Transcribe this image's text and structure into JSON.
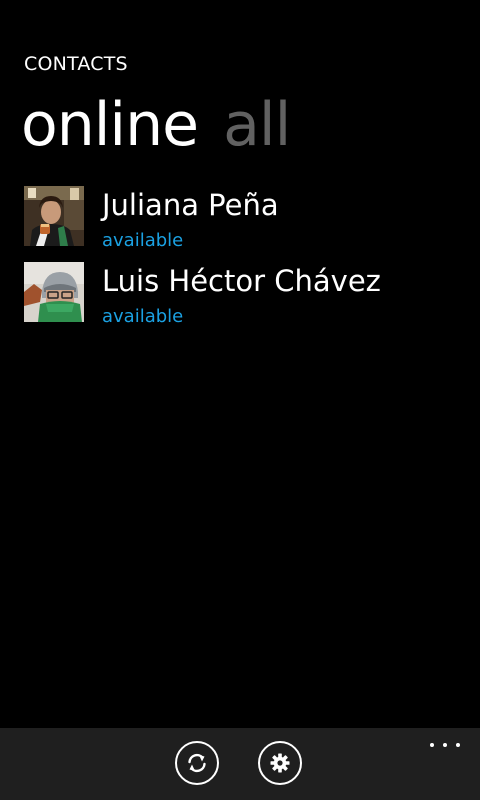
{
  "header": {
    "app_title": "CONTACTS"
  },
  "pivot": {
    "items": [
      {
        "label": "online",
        "active": true
      },
      {
        "label": "all",
        "active": false
      }
    ]
  },
  "contacts": [
    {
      "name": "Juliana Peña",
      "status": "available",
      "avatar_icon": "contact-photo"
    },
    {
      "name": "Luis Héctor Chávez",
      "status": "available",
      "avatar_icon": "contact-photo"
    }
  ],
  "app_bar": {
    "buttons": [
      {
        "icon": "sync-icon"
      },
      {
        "icon": "gear-icon"
      }
    ],
    "more_icon": "ellipsis-icon"
  },
  "colors": {
    "background": "#000000",
    "accent": "#1ba1e2",
    "inactive_pivot": "#616161",
    "app_bar": "#1f1f1f"
  }
}
